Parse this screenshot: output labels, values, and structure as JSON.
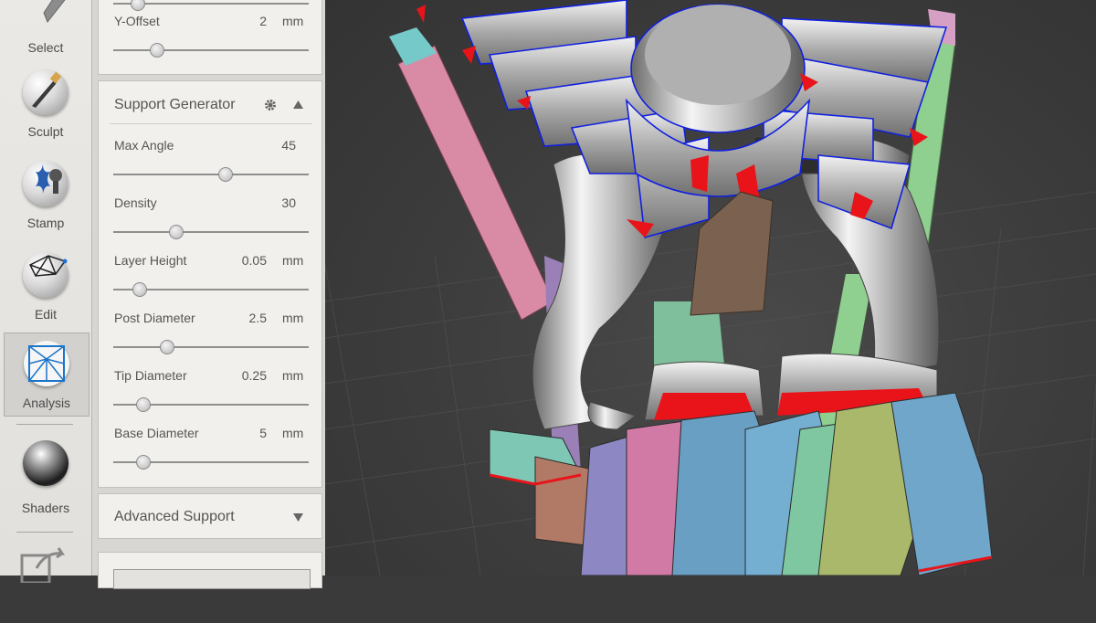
{
  "toolbar": {
    "select": "Select",
    "sculpt": "Sculpt",
    "stamp": "Stamp",
    "edit": "Edit",
    "analysis": "Analysis",
    "shaders": "Shaders"
  },
  "offset_panel": {
    "y_offset": {
      "label": "Y-Offset",
      "value": "2",
      "unit": "mm",
      "position": 0.22
    }
  },
  "support_generator": {
    "title": "Support Generator",
    "rows": [
      {
        "label": "Max Angle",
        "value": "45",
        "unit": "",
        "position": 0.57
      },
      {
        "label": "Density",
        "value": "30",
        "unit": "",
        "position": 0.32
      },
      {
        "label": "Layer Height",
        "value": "0.05",
        "unit": "mm",
        "position": 0.13
      },
      {
        "label": "Post Diameter",
        "value": "2.5",
        "unit": "mm",
        "position": 0.27
      },
      {
        "label": "Tip Diameter",
        "value": "0.25",
        "unit": "mm",
        "position": 0.15
      },
      {
        "label": "Base Diameter",
        "value": "5",
        "unit": "mm",
        "position": 0.15
      }
    ]
  },
  "advanced_support": {
    "title": "Advanced Support"
  },
  "colors": {
    "panel": "#f2f0ec",
    "viewport": "#3c3c3c",
    "support_red": "#e8141a",
    "outline_blue": "#1020e0"
  }
}
